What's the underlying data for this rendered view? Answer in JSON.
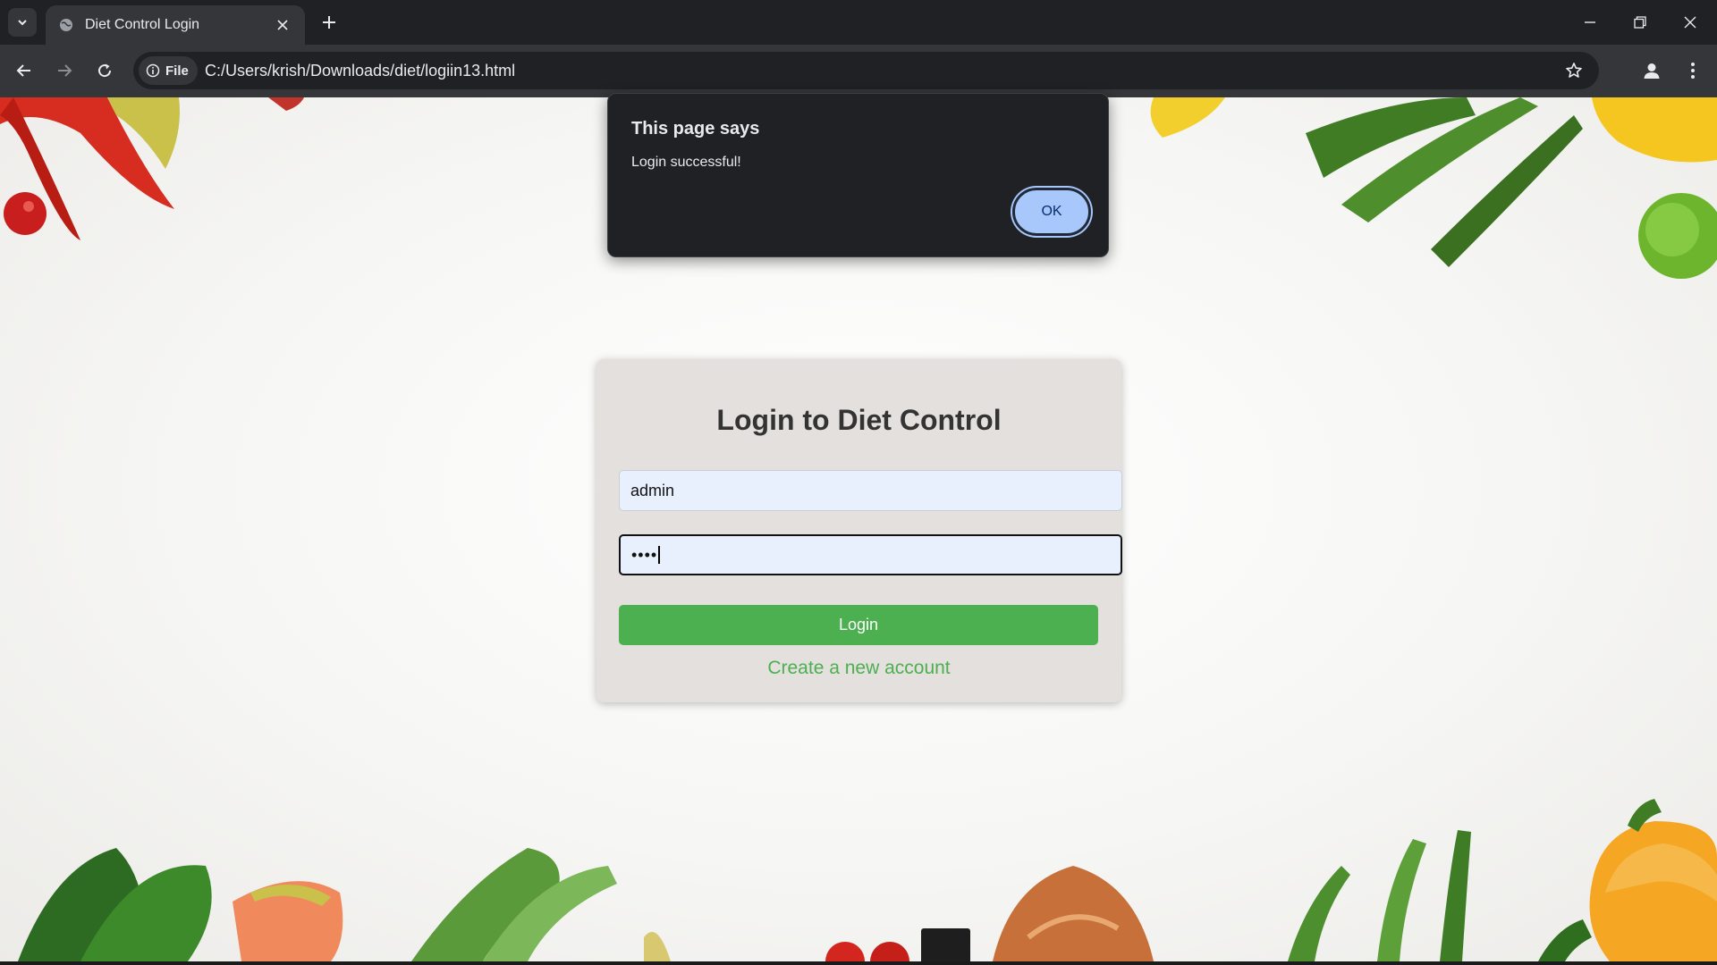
{
  "browser": {
    "tab_title": "Diet Control Login",
    "url": "C:/Users/krish/Downloads/diet/logiin13.html",
    "site_chip_label": "File"
  },
  "page": {
    "heading": "Login to Diet Control",
    "username_value": "admin",
    "password_masked": "••••",
    "login_button": "Login",
    "create_account_link": "Create a new account"
  },
  "dialog": {
    "title": "This page says",
    "message": "Login successful!",
    "ok_label": "OK"
  },
  "colors": {
    "accent_green": "#4caf50",
    "dialog_button": "#a8c7fa",
    "chrome_dark": "#202124",
    "chrome_toolbar": "#35363a"
  },
  "icons": [
    "tab-search-icon",
    "globe-icon",
    "close-icon",
    "plus-icon",
    "minimize-icon",
    "restore-icon",
    "back-arrow-icon",
    "forward-arrow-icon",
    "reload-icon",
    "info-icon",
    "star-icon",
    "profile-icon",
    "more-vert-icon"
  ]
}
